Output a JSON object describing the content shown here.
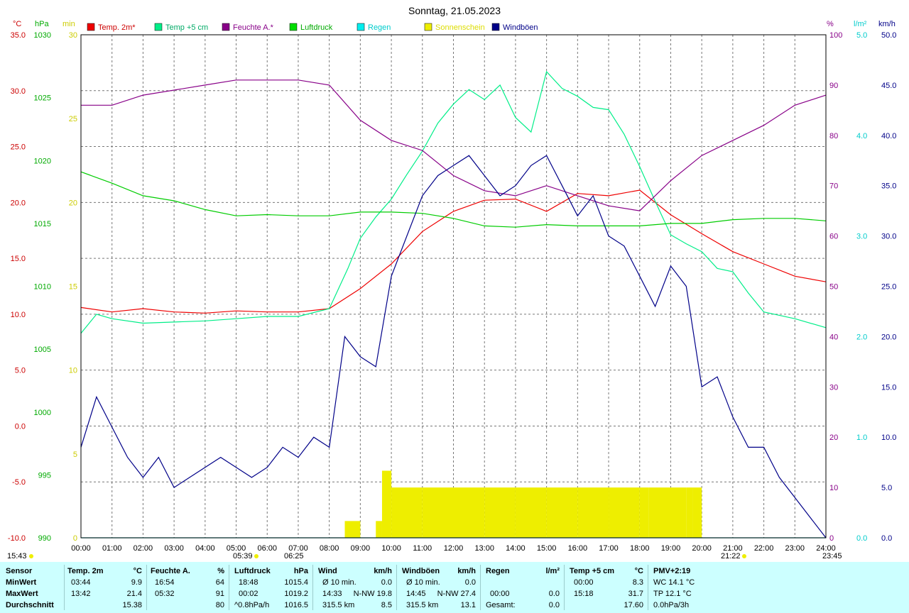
{
  "title": "Sonntag, 21.05.2023",
  "legend": [
    {
      "label": "Temp. 2m*",
      "color": "#ee0000"
    },
    {
      "label": "Temp +5 cm",
      "color": "#00ee88"
    },
    {
      "label": "Feuchte A.*",
      "color": "#880088"
    },
    {
      "label": "Luftdruck",
      "color": "#00dd00"
    },
    {
      "label": "Regen",
      "color": "#00eeee"
    },
    {
      "label": "Sonnenschein",
      "color": "#eeee00"
    },
    {
      "label": "Windböen",
      "color": "#000088"
    }
  ],
  "axis_units": {
    "temp": "°C",
    "pressure": "hPa",
    "sun": "min",
    "humidity": "%",
    "rain": "l/m²",
    "wind": "km/h"
  },
  "bottom_marks": {
    "left_time": "15:43",
    "sunrise1": "05:39",
    "sunrise2": "06:25",
    "sunset": "21:22",
    "right_time": "23:45"
  },
  "colors": {
    "temp": "#ee0000",
    "pressure": "#00cc00",
    "humidity": "#880088",
    "temp5": "#00ee88",
    "rain": "#00cccc",
    "sun": "#eeee00",
    "wind": "#000088",
    "grid": "#777777"
  },
  "chart_data": {
    "type": "line",
    "x_labels": [
      "00:00",
      "01:00",
      "02:00",
      "03:00",
      "04:00",
      "05:00",
      "06:00",
      "07:00",
      "08:00",
      "09:00",
      "10:00",
      "11:00",
      "12:00",
      "13:00",
      "14:00",
      "15:00",
      "16:00",
      "17:00",
      "18:00",
      "19:00",
      "20:00",
      "21:00",
      "22:00",
      "23:00",
      "24:00"
    ],
    "axes": {
      "temp": {
        "unit": "°C",
        "range": [
          -10,
          35
        ],
        "ticks": [
          "35.0",
          "30.0",
          "25.0",
          "20.0",
          "15.0",
          "10.0",
          "5.0",
          "0.0",
          "-5.0",
          "-10.0"
        ]
      },
      "pressure": {
        "unit": "hPa",
        "range": [
          990,
          1030
        ],
        "ticks": [
          "1030",
          "1025",
          "1020",
          "1015",
          "1010",
          "1005",
          "1000",
          "995",
          "990"
        ]
      },
      "sun": {
        "unit": "min",
        "range": [
          0,
          30
        ],
        "ticks": [
          "30",
          "25",
          "20",
          "15",
          "10",
          "5",
          "0"
        ]
      },
      "humidity": {
        "unit": "%",
        "range": [
          0,
          100
        ],
        "ticks": [
          "100",
          "90",
          "80",
          "70",
          "60",
          "50",
          "40",
          "30",
          "20",
          "10",
          "0"
        ]
      },
      "rain": {
        "unit": "l/m²",
        "range": [
          0,
          5
        ],
        "ticks": [
          "5.0",
          "4.0",
          "3.0",
          "2.0",
          "1.0",
          "0.0"
        ]
      },
      "wind": {
        "unit": "km/h",
        "range": [
          0,
          50
        ],
        "ticks": [
          "50.0",
          "45.0",
          "40.0",
          "35.0",
          "30.0",
          "25.0",
          "20.0",
          "15.0",
          "10.0",
          "5.0",
          "0.0"
        ]
      }
    },
    "series": [
      {
        "name": "Temp. 2m*",
        "axis": "temp",
        "x": [
          0,
          1,
          2,
          3,
          4,
          5,
          6,
          7,
          8,
          9,
          10,
          11,
          12,
          13,
          14,
          15,
          16,
          17,
          18,
          19,
          20,
          21,
          22,
          23,
          24
        ],
        "y": [
          10.6,
          10.2,
          10.5,
          10.2,
          10.1,
          10.3,
          10.2,
          10.2,
          10.5,
          12.3,
          14.5,
          17.4,
          19.2,
          20.2,
          20.3,
          19.2,
          20.8,
          20.6,
          21.1,
          18.9,
          17.2,
          15.6,
          14.5,
          13.4,
          12.9
        ]
      },
      {
        "name": "Temp +5 cm",
        "axis": "temp",
        "x": [
          0,
          0.5,
          1,
          2,
          3,
          4,
          5,
          6,
          7,
          8,
          8.6,
          9,
          9.5,
          10,
          10.5,
          11,
          11.5,
          12,
          12.5,
          13,
          13.5,
          14,
          14.5,
          15,
          15.5,
          16,
          16.5,
          17,
          17.5,
          18,
          18.5,
          19,
          19.5,
          20,
          20.5,
          21,
          21.5,
          22,
          23,
          24
        ],
        "y": [
          8.3,
          10,
          9.6,
          9.2,
          9.3,
          9.4,
          9.6,
          9.8,
          9.8,
          10.5,
          14.1,
          16.8,
          18.7,
          20.3,
          22.5,
          24.6,
          27.1,
          28.8,
          30.1,
          29.2,
          30.5,
          27.6,
          26.3,
          31.7,
          30.2,
          29.5,
          28.5,
          28.3,
          26.1,
          23.2,
          20.1,
          17.1,
          16.3,
          15.6,
          14.1,
          13.8,
          11.9,
          10.2,
          9.6,
          8.8
        ]
      },
      {
        "name": "Feuchte A.*",
        "axis": "humidity",
        "x": [
          0,
          1,
          2,
          3,
          4,
          5,
          6,
          7,
          8,
          9,
          10,
          11,
          12,
          13,
          14,
          15,
          16,
          17,
          18,
          19,
          20,
          21,
          22,
          23,
          24
        ],
        "y": [
          86,
          86,
          88,
          89,
          90,
          91,
          91,
          91,
          90,
          83,
          79,
          77,
          72,
          69,
          68,
          70,
          68,
          66,
          65,
          71,
          76,
          79,
          82,
          86,
          88
        ]
      },
      {
        "name": "Luftdruck",
        "axis": "pressure",
        "x": [
          0,
          1,
          2,
          3,
          4,
          5,
          6,
          7,
          8,
          9,
          10,
          11,
          12,
          13,
          14,
          15,
          16,
          17,
          18,
          19,
          20,
          21,
          22,
          23,
          24
        ],
        "y": [
          1019.1,
          1018.2,
          1017.2,
          1016.8,
          1016.1,
          1015.6,
          1015.7,
          1015.6,
          1015.6,
          1015.9,
          1015.9,
          1015.8,
          1015.4,
          1014.8,
          1014.7,
          1014.9,
          1014.8,
          1014.8,
          1014.8,
          1015.0,
          1015.0,
          1015.3,
          1015.4,
          1015.4,
          1015.2
        ]
      },
      {
        "name": "Regen",
        "axis": "rain",
        "x": [
          0,
          24
        ],
        "y": [
          0,
          0
        ]
      },
      {
        "name": "Sonnenschein",
        "axis": "sun",
        "x": [
          8.5,
          9,
          9.5,
          9.7,
          10,
          11,
          12,
          13,
          14,
          15,
          16,
          17,
          18,
          18.3,
          19.5,
          19.7,
          20
        ],
        "y": [
          1,
          0,
          1,
          4,
          3,
          3,
          3,
          3,
          3,
          3,
          3,
          3,
          3,
          3,
          3,
          3,
          0
        ]
      },
      {
        "name": "Windböen",
        "axis": "wind",
        "x": [
          0,
          0.5,
          1,
          1.5,
          2,
          2.5,
          3,
          3.5,
          4,
          4.5,
          5,
          5.5,
          6,
          6.5,
          7,
          7.5,
          8,
          8.5,
          9,
          9.5,
          10,
          10.5,
          11,
          11.5,
          12,
          12.5,
          13,
          13.5,
          14,
          14.5,
          15,
          15.5,
          16,
          16.5,
          17,
          17.5,
          18,
          18.5,
          19,
          19.5,
          20,
          20.5,
          21,
          21.5,
          22,
          22.5,
          23,
          23.5,
          24
        ],
        "y": [
          9,
          14,
          11,
          8,
          6,
          8,
          5,
          6,
          7,
          8,
          7,
          6,
          7,
          9,
          8,
          10,
          9,
          20,
          18,
          17,
          26,
          30,
          34,
          36,
          37,
          38,
          36,
          34,
          35,
          37,
          38,
          35,
          32,
          34,
          30,
          29,
          26,
          23,
          27,
          25,
          15,
          16,
          12,
          9,
          9,
          6,
          4,
          2,
          0
        ]
      }
    ]
  },
  "summary": {
    "row_labels": [
      "Sensor",
      "MinWert",
      "MaxWert",
      "Durchschnitt"
    ],
    "temp2m": {
      "title": "Temp. 2m",
      "unit": "°C",
      "min_time": "03:44",
      "min": "9.9",
      "max_time": "13:42",
      "max": "21.4",
      "avg": "15.38"
    },
    "humidity": {
      "title": "Feuchte A.",
      "unit": "%",
      "min_time": "16:54",
      "min": "64",
      "max_time": "05:32",
      "max": "91",
      "avg": "80"
    },
    "pressure": {
      "title": "Luftdruck",
      "unit": "hPa",
      "min_time": "18:48",
      "min": "1015.4",
      "max_time": "00:02",
      "max": "1019.2",
      "trend": "^0.8hPa/h",
      "avg": "1016.5"
    },
    "wind": {
      "title": "Wind",
      "unit": "km/h",
      "r1a": "Ø 10 min.",
      "r1b": "0.0",
      "r2a": "14:33",
      "r2b": "N-NW 19.8",
      "r3a": "315.5 km",
      "r3b": "8.5"
    },
    "gusts": {
      "title": "Windböen",
      "unit": "km/h",
      "r1a": "Ø 10 min.",
      "r1b": "0.0",
      "r2a": "14:45",
      "r2b": "N-NW 27.4",
      "r3a": "315.5 km",
      "r3b": "13.1"
    },
    "rain": {
      "title": "Regen",
      "unit": "l/m²",
      "r2a": "00:00",
      "r2b": "0.0",
      "r3a": "Gesamt:",
      "r3b": "0.0"
    },
    "temp5": {
      "title": "Temp +5 cm",
      "unit": "°C",
      "min_time": "00:00",
      "min": "8.3",
      "max_time": "15:18",
      "max": "31.7",
      "avg": "17.60"
    },
    "pmv": {
      "title": "PMV+2:19",
      "l1": "WC 14.1 °C",
      "l2": "TP 12.1 °C",
      "l3": "0.0hPa/3h"
    }
  }
}
